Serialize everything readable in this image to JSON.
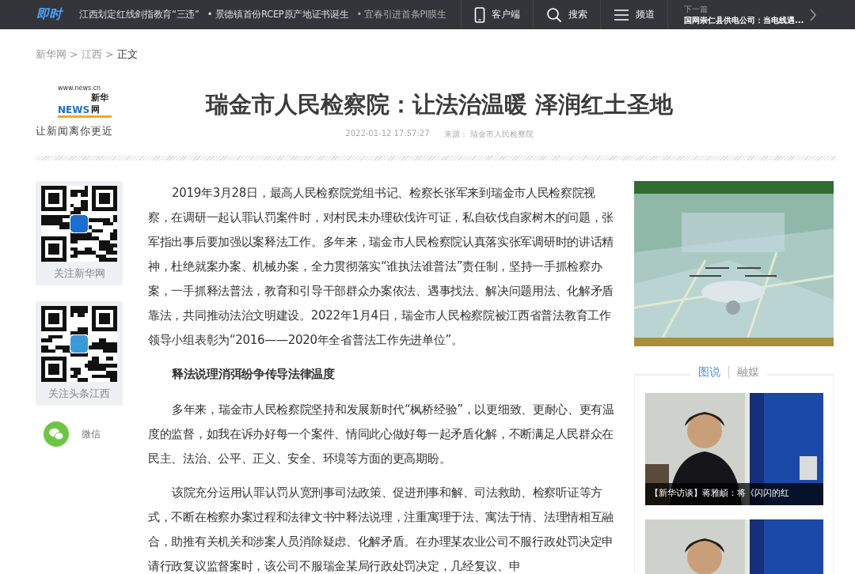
{
  "topbar": {
    "logo": "即时",
    "ticker": [
      "江西划定红线剑指教育“三违”",
      "• 景德镇首份RCEP原产地证书诞生",
      "• 宜春引进首条PI膜生"
    ],
    "actions": [
      {
        "kind": "phone",
        "label": "客户端"
      },
      {
        "kind": "search",
        "label": "搜索"
      },
      {
        "kind": "menu",
        "label": "频道"
      }
    ],
    "next": {
      "label": "下一篇",
      "title": "国网崇仁县供电公司：当电线遇..."
    }
  },
  "breadcrumb_separator": ">",
  "breadcrumb": [
    {
      "label": "新华网",
      "current": false
    },
    {
      "label": "江西",
      "current": false
    },
    {
      "label": "正文",
      "current": true
    }
  ],
  "logo": {
    "url": "www.news.cn",
    "name": "新华网",
    "news": "NEWS",
    "slogan": "让新闻离你更近"
  },
  "article": {
    "title": "瑞金市人民检察院：让法治温暖 泽润红土圣地",
    "date": "2022-01-12 17:57:27",
    "source": "来源： 瑞金市人民检察院",
    "blocks": [
      {
        "kind": "para",
        "text": "2019年3月28日，最高人民检察院党组书记、检察长张军来到瑞金市人民检察院视察，在调研一起认罪认罚案件时，对村民未办理砍伐许可证，私自砍伐自家树木的问题，张军指出事后要加强以案释法工作。多年来，瑞金市人民检察院认真落实张军调研时的讲话精神，杜绝就案办案、机械办案，全力贯彻落实“谁执法谁普法”责任制，坚持一手抓检察办案，一手抓释法普法，教育和引导干部群众办案依法、遇事找法、解决问题用法、化解矛盾靠法，共同推动法治文明建设。2022年1月4日，瑞金市人民检察院被江西省普法教育工作领导小组表彰为“2016——2020年全省普法工作先进单位”。"
      },
      {
        "kind": "heading",
        "text": "释法说理消弭纷争传导法律温度"
      },
      {
        "kind": "para",
        "text": "多年来，瑞金市人民检察院坚持和发展新时代“枫桥经验”，以更细致、更耐心、更有温度的监督，如我在诉办好每一个案件、情同此心做好每一起矛盾化解，不断满足人民群众在民主、法治、公平、正义、安全、环境等方面的更高期盼。"
      },
      {
        "kind": "para",
        "text": "该院充分运用认罪认罚从宽刑事司法政策、促进刑事和解、司法救助、检察听证等方式，不断在检察办案过程和法律文书中释法说理，注重寓理于法、寓法于情、法理情相互融合，助推有关机关和涉案人员消除疑虑、化解矛盾。在办理某农业公司不服行政处罚决定申请行政复议监督案时，该公司不服瑞金某局行政处罚决定，几经复议、申"
      }
    ]
  },
  "share": [
    {
      "kind": "qr",
      "label": "关注新华网"
    },
    {
      "kind": "qr",
      "label": "关注头条江西"
    },
    {
      "kind": "wechat",
      "label": "微信"
    }
  ],
  "sidebar": {
    "tabs": [
      {
        "label": "图说",
        "selected": true
      },
      {
        "label": "融媒",
        "selected": false
      }
    ],
    "cards": [
      {
        "kind": "captioned",
        "caption": "【新华访谈】蒋雅頔：将《闪闪的红"
      },
      {
        "kind": "picture"
      }
    ]
  }
}
